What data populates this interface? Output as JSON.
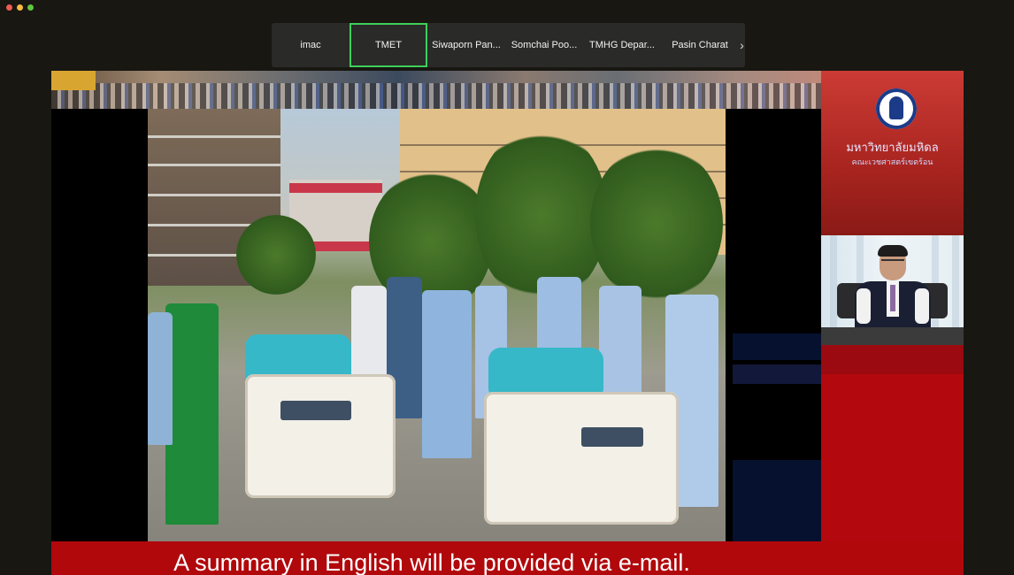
{
  "window": {
    "traffic_lights": {
      "close": "#ee5c52",
      "minimize": "#f4bd40",
      "zoom": "#5fc83f"
    }
  },
  "participants": [
    {
      "name": "imac",
      "active": false
    },
    {
      "name": "TMET",
      "active": true
    },
    {
      "name": "Siwaporn Pan...",
      "active": false
    },
    {
      "name": "Somchai Poo...",
      "active": false
    },
    {
      "name": "TMHG Depar...",
      "active": false
    },
    {
      "name": "Pasin Charat",
      "active": false
    }
  ],
  "gallery_next_icon": "chevron-right-icon",
  "gallery_next_glyph": "›",
  "colors": {
    "active_speaker_border": "#3fcf5a",
    "caption_bar": "#b1080c",
    "background": "#181712"
  },
  "shared_screen": {
    "caption": "A summary in English will be provided via e-mail.",
    "logo_text_line1": "มหาวิทยาลัยมหิดล",
    "logo_text_line2": "คณะเวชศาสตร์เขตร้อน"
  }
}
